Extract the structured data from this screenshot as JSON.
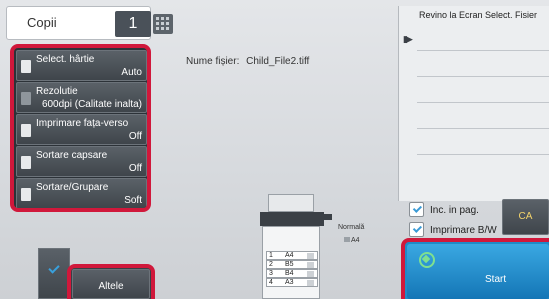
{
  "copies": {
    "label": "Copii",
    "value": "1"
  },
  "settings": [
    {
      "label": "Select. hârtie",
      "value": "Auto",
      "icon": "paper-icon"
    },
    {
      "label": "Rezolutie",
      "value": "600dpi (Calitate inalta)",
      "icon": "resolution-icon"
    },
    {
      "label": "Imprimare fața-verso",
      "value": "Off",
      "icon": "duplex-icon"
    },
    {
      "label": "Sortare capsare",
      "value": "Off",
      "icon": "staple-icon"
    },
    {
      "label": "Sortare/Grupare",
      "value": "Soft",
      "icon": "sort-icon"
    }
  ],
  "file": {
    "label": "Nume fișier:",
    "name": "Child_File2.tiff"
  },
  "machine": {
    "output": "Normală",
    "output_size": "A4",
    "trays": [
      {
        "num": "1",
        "size": "A4"
      },
      {
        "num": "2",
        "size": "B5"
      },
      {
        "num": "3",
        "size": "B4"
      },
      {
        "num": "4",
        "size": "A3"
      }
    ]
  },
  "right": {
    "back_label": "Revino la Ecran Select. Fisier",
    "checkboxes": [
      {
        "label": "Inc. in pag.",
        "checked": true
      },
      {
        "label": "Imprimare B/W",
        "checked": true
      }
    ],
    "ca_label": "CA",
    "start_label": "Start"
  },
  "bottom": {
    "others_label": "Altele"
  },
  "colors": {
    "highlight": "#d0183b",
    "start": "#1f8ac7",
    "accent": "#39a0dc"
  }
}
